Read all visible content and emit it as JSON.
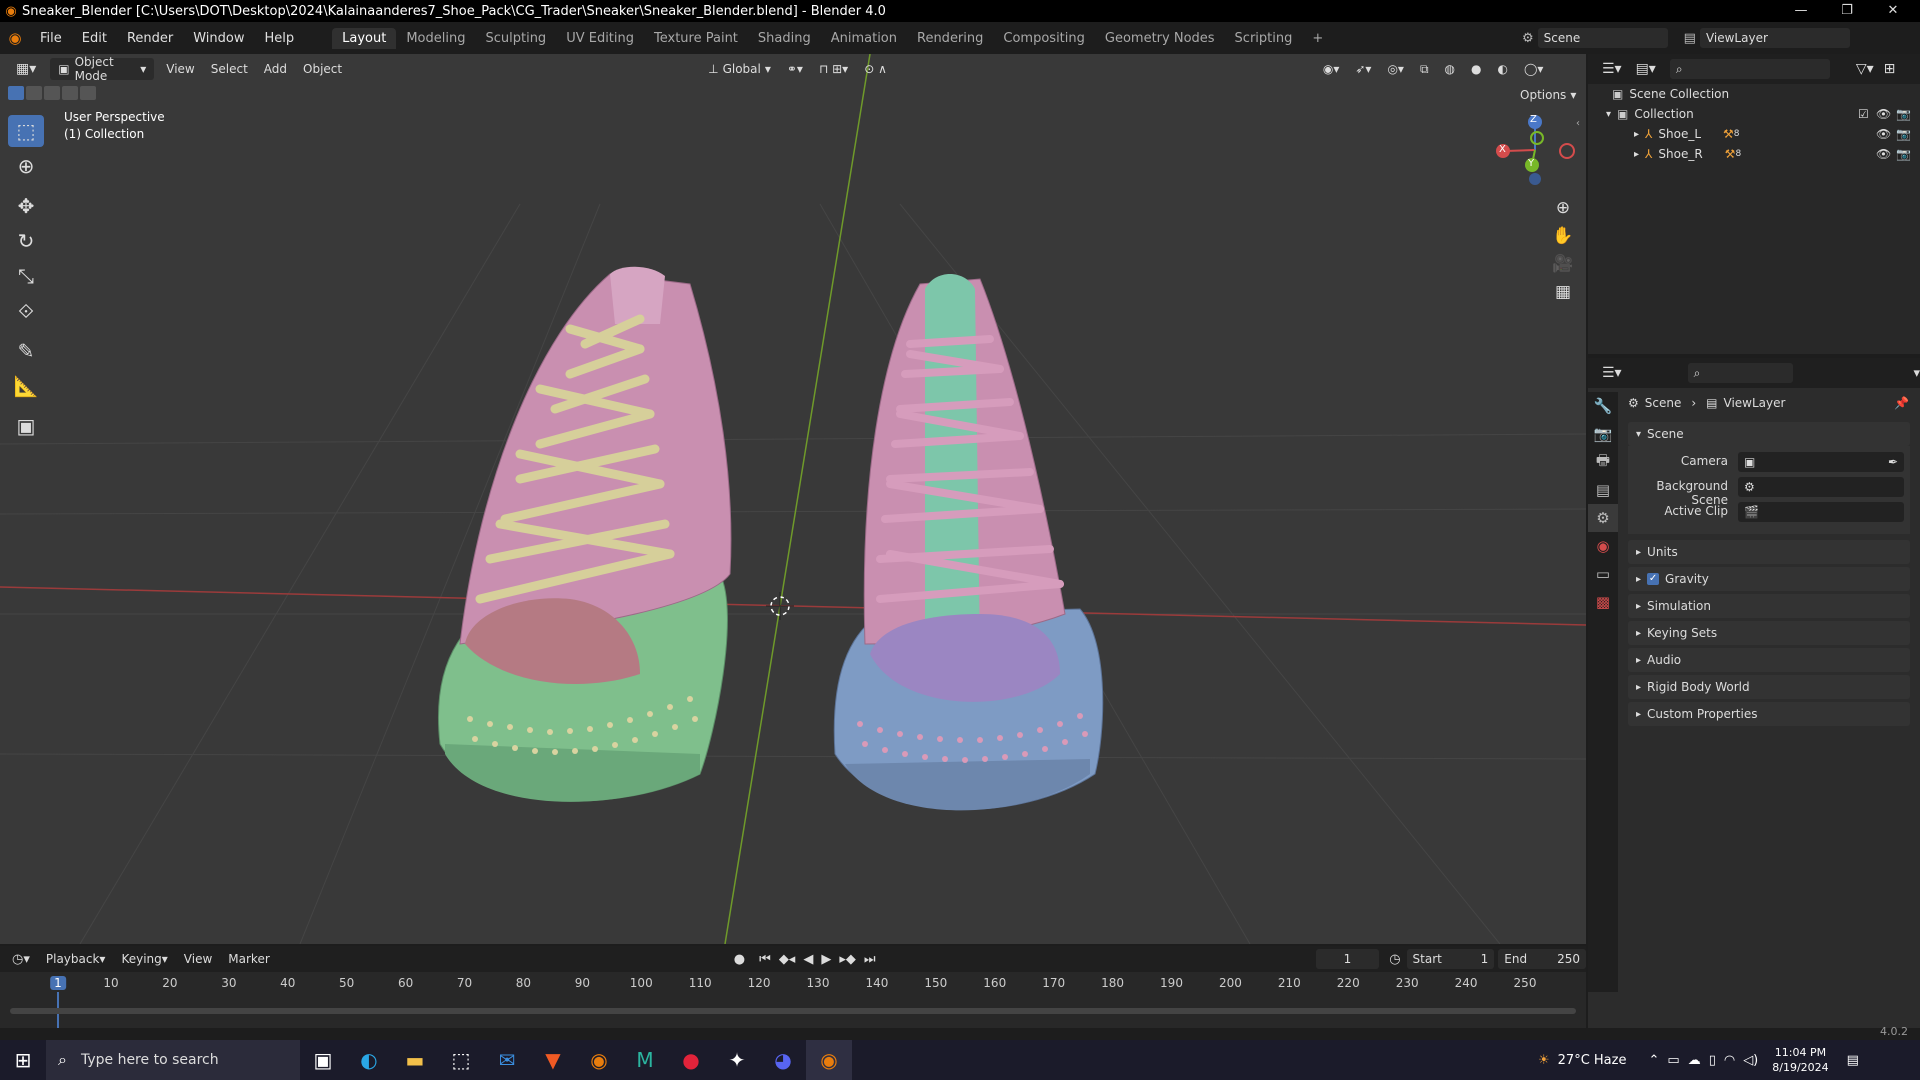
{
  "window": {
    "title": "Sneaker_Blender [C:\\Users\\DOT\\Desktop\\2024\\Kalainaanderes7_Shoe_Pack\\CG_Trader\\Sneaker\\Sneaker_Blender.blend] - Blender 4.0",
    "minimize": "—",
    "restore": "❐",
    "close": "✕"
  },
  "menu": [
    "File",
    "Edit",
    "Render",
    "Window",
    "Help"
  ],
  "workspaces": [
    "Layout",
    "Modeling",
    "Sculpting",
    "UV Editing",
    "Texture Paint",
    "Shading",
    "Animation",
    "Rendering",
    "Compositing",
    "Geometry Nodes",
    "Scripting"
  ],
  "active_workspace": "Layout",
  "add_workspace": "+",
  "scene_selector": {
    "value": "Scene"
  },
  "viewlayer_selector": {
    "value": "ViewLayer"
  },
  "viewport": {
    "mode": "Object Mode",
    "menus": [
      "View",
      "Select",
      "Add",
      "Object"
    ],
    "transform_orientation": "Global",
    "options": "Options",
    "overlay_title": "User Perspective",
    "overlay_collection": "(1) Collection",
    "gizmo": {
      "z": "Z",
      "y": "Y",
      "x": "X"
    }
  },
  "outliner": {
    "root": "Scene Collection",
    "collection": "Collection",
    "objects": [
      {
        "name": "Shoe_L",
        "modifier_badge": "8"
      },
      {
        "name": "Shoe_R",
        "modifier_badge": "8"
      }
    ]
  },
  "properties": {
    "breadcrumb_scene": "Scene",
    "breadcrumb_separator": "›",
    "breadcrumb_viewlayer": "ViewLayer",
    "section": "Scene",
    "fields": [
      {
        "label": "Camera",
        "value": ""
      },
      {
        "label": "Background Scene",
        "value": ""
      },
      {
        "label": "Active Clip",
        "value": ""
      }
    ],
    "panels": [
      "Units",
      "Gravity",
      "Simulation",
      "Keying Sets",
      "Audio",
      "Rigid Body World",
      "Custom Properties"
    ],
    "gravity_checked": true
  },
  "timeline": {
    "menus": [
      "Playback",
      "Keying",
      "View",
      "Marker"
    ],
    "current_frame": "1",
    "start_label": "Start",
    "start": "1",
    "end_label": "End",
    "end": "250",
    "ticks": [
      "1",
      "10",
      "20",
      "30",
      "40",
      "50",
      "60",
      "70",
      "80",
      "90",
      "100",
      "110",
      "120",
      "130",
      "140",
      "150",
      "160",
      "170",
      "180",
      "190",
      "200",
      "210",
      "220",
      "230",
      "240",
      "250"
    ]
  },
  "status": {
    "version": "4.0.2"
  },
  "taskbar": {
    "search_placeholder": "Type here to search",
    "weather": "27°C  Haze",
    "time": "11:04 PM",
    "date": "8/19/2024"
  },
  "colors": {
    "accent": "#4772b3",
    "shoe_upper": "#c98fb0",
    "laces_left": "#d6cf9a",
    "sole_left": "#7fbf8c",
    "sole_right": "#7e9bc4",
    "toe_left": "#b57a83",
    "toe_right": "#9b86c2",
    "tongue_right": "#7dc6aa"
  }
}
